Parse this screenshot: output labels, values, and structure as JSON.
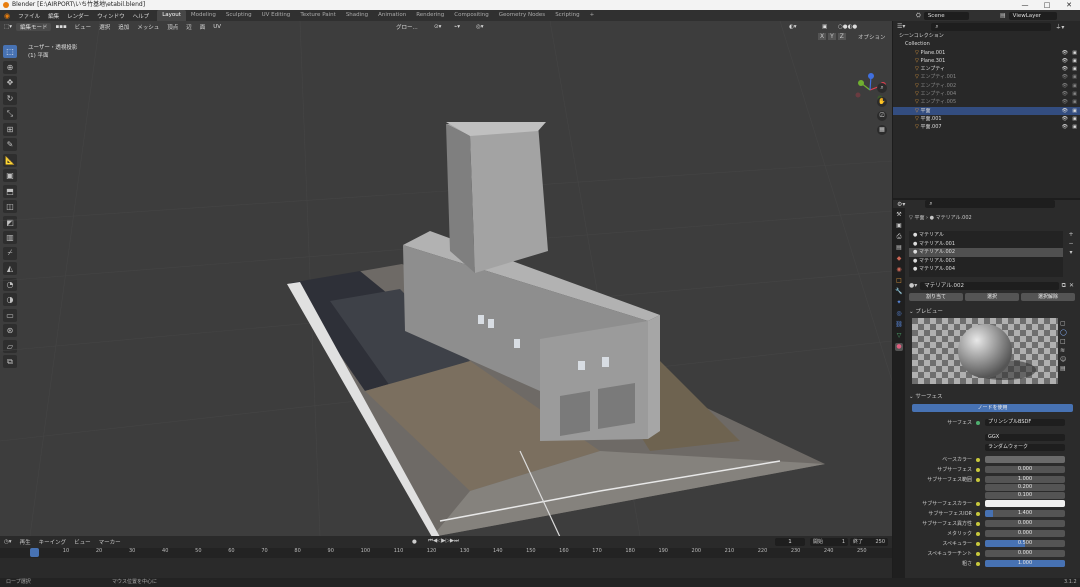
{
  "window": {
    "title": "Blender [E:\\AIRPORT\\いち竹基地\\etabil.blend]",
    "controls": [
      "—",
      "□",
      "✕"
    ]
  },
  "menubar": {
    "items": [
      "ファイル",
      "編集",
      "レンダー",
      "ウィンドウ",
      "ヘルプ"
    ],
    "workspaces": [
      "Layout",
      "Modeling",
      "Sculpting",
      "UV Editing",
      "Texture Paint",
      "Shading",
      "Animation",
      "Rendering",
      "Compositing",
      "Geometry Nodes",
      "Scripting",
      "+"
    ],
    "active_workspace": "Layout",
    "scene": "Scene",
    "view_layer": "ViewLayer"
  },
  "viewport": {
    "mode": "編集モード",
    "menus": [
      "ビュー",
      "選択",
      "追加",
      "メッシュ",
      "頂点",
      "辺",
      "面",
      "UV"
    ],
    "orientation": "グロー...",
    "options_label": "オプション",
    "info_line1": "ユーザー・透視投影",
    "info_line2": "(1) 平面",
    "axes": [
      "X",
      "Y",
      "Z"
    ],
    "tools": [
      "select-box",
      "cursor",
      "move",
      "rotate",
      "scale",
      "transform",
      "annotate",
      "measure",
      "add-cube",
      "extrude",
      "inset",
      "bevel",
      "loop-cut",
      "knife",
      "poly-build",
      "spin",
      "smooth",
      "edge-slide",
      "shrink",
      "shear",
      "rip"
    ]
  },
  "outliner": {
    "header": "シーンコレクション",
    "collection": "Collection",
    "items": [
      {
        "name": "Plane.001",
        "dim": false,
        "selected": false
      },
      {
        "name": "Plane.301",
        "dim": false,
        "selected": false
      },
      {
        "name": "エンプティ",
        "dim": false,
        "selected": false
      },
      {
        "name": "エンプティ.001",
        "dim": true,
        "selected": false
      },
      {
        "name": "エンプティ.002",
        "dim": true,
        "selected": false
      },
      {
        "name": "エンプティ.004",
        "dim": true,
        "selected": false
      },
      {
        "name": "エンプティ.005",
        "dim": true,
        "selected": false
      },
      {
        "name": "平面",
        "dim": false,
        "selected": true
      },
      {
        "name": "平面.001",
        "dim": false,
        "selected": false
      },
      {
        "name": "平面.007",
        "dim": false,
        "selected": false
      }
    ]
  },
  "properties": {
    "breadcrumb_object": "平面",
    "breadcrumb_material": "マテリアル.002",
    "materials": [
      "マテリアル",
      "マテリアル.001",
      "マテリアル.002",
      "マテリアル.003",
      "マテリアル.004"
    ],
    "selected_material_index": 2,
    "material_field": "マテリアル.002",
    "buttons": [
      "割り当て",
      "選択",
      "選択解除"
    ],
    "preview_label": "プレビュー",
    "surface_section": "サーフェス",
    "use_nodes": "ノードを使用",
    "surface_label": "サーフェス",
    "surface_value": "プリンシプルBSDF",
    "distribution": "GGX",
    "subsurface_method": "ランダムウォーク",
    "rows": [
      {
        "label": "ベースカラー",
        "value": "",
        "fill": 0
      },
      {
        "label": "サブサーフェス",
        "value": "0.000",
        "fill": 0
      },
      {
        "label": "サブサーフェス範囲",
        "value": "1.000",
        "fill": 0
      },
      {
        "label": "",
        "value": "0.200",
        "fill": 0
      },
      {
        "label": "",
        "value": "0.100",
        "fill": 0
      },
      {
        "label": "サブサーフェスカラー",
        "value": "",
        "fill": 0
      },
      {
        "label": "サブサーフェスIOR",
        "value": "1.400",
        "fill": 0.1
      },
      {
        "label": "サブサーフェス異方性",
        "value": "0.000",
        "fill": 0
      },
      {
        "label": "メタリック",
        "value": "0.000",
        "fill": 0
      },
      {
        "label": "スペキュラー",
        "value": "0.500",
        "fill": 0.5
      },
      {
        "label": "スペキュラーチント",
        "value": "0.000",
        "fill": 0
      },
      {
        "label": "粗さ",
        "value": "1.000",
        "fill": 1
      }
    ]
  },
  "timeline": {
    "menus": [
      "再生",
      "キーイング",
      "ビュー",
      "マーカー"
    ],
    "current_frame": "1",
    "start_label": "開始",
    "start": "1",
    "end_label": "終了",
    "end": "250",
    "ticks": [
      "1",
      "10",
      "20",
      "30",
      "40",
      "50",
      "60",
      "70",
      "80",
      "90",
      "100",
      "110",
      "120",
      "130",
      "140",
      "150",
      "160",
      "170",
      "180",
      "190",
      "200",
      "210",
      "220",
      "230",
      "240",
      "250"
    ]
  },
  "statusbar": {
    "left": "ロープ選択",
    "middle": "マウス位置を中心に",
    "version": "3.1.2"
  }
}
